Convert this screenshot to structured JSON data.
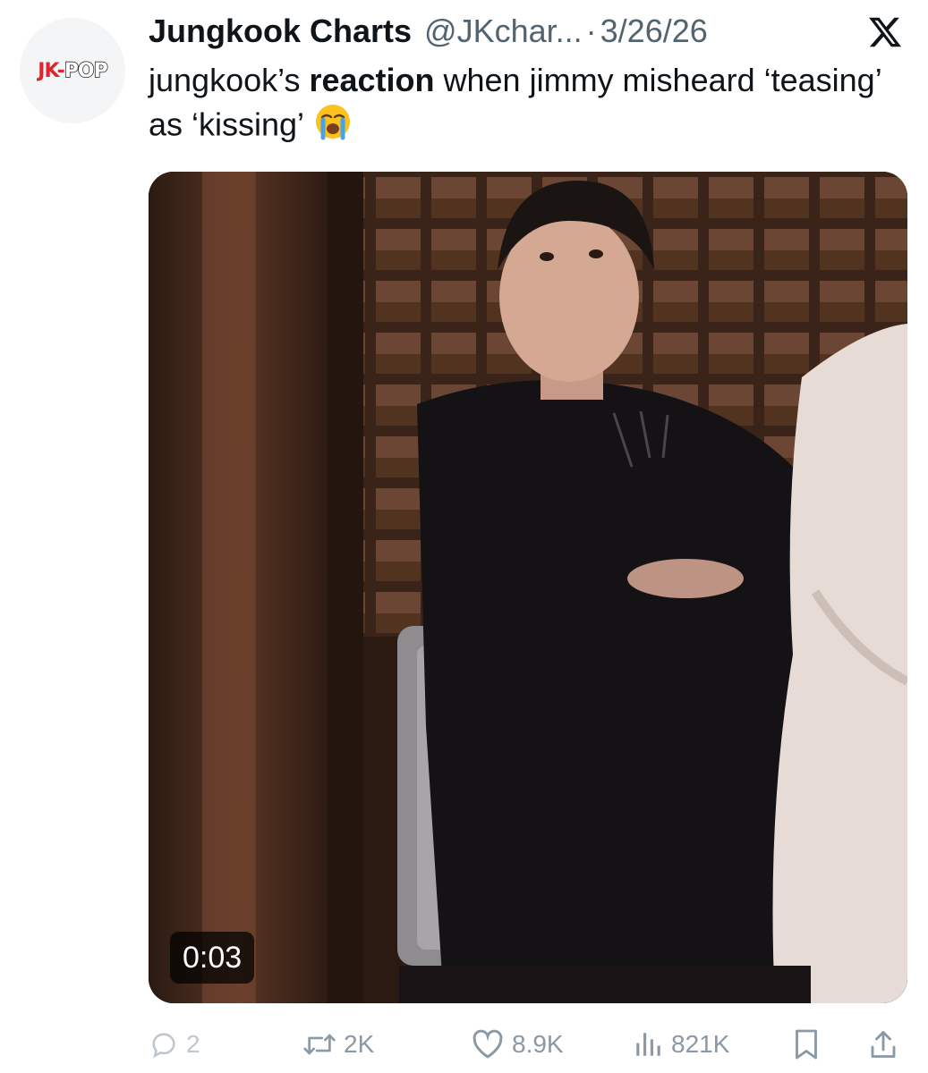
{
  "author": {
    "display_name": "Jungkook Charts",
    "handle": "@JKchar...",
    "separator": "·",
    "date": "3/26/26",
    "avatar_text": {
      "jk": "JK",
      "dash": "-",
      "pop": "POP"
    }
  },
  "tweet": {
    "text_before": "jungkook’s ",
    "text_bold": "reaction",
    "text_after": " when jimmy misheard ‘teasing’ as ‘kissing’",
    "emoji": "loudly-crying-face"
  },
  "media": {
    "type": "video",
    "time": "0:03"
  },
  "actions": {
    "replies": "2",
    "reposts": "2K",
    "likes": "8.9K",
    "views": "821K"
  },
  "icons": {
    "platform": "x-logo",
    "reply": "reply-icon",
    "repost": "repost-icon",
    "like": "heart-icon",
    "views": "views-icon",
    "bookmark": "bookmark-icon",
    "share": "share-icon"
  },
  "colors": {
    "text": "#0f1419",
    "secondary": "#536471",
    "action_gray": "#8b98a5",
    "logo_red": "#e0242b"
  }
}
